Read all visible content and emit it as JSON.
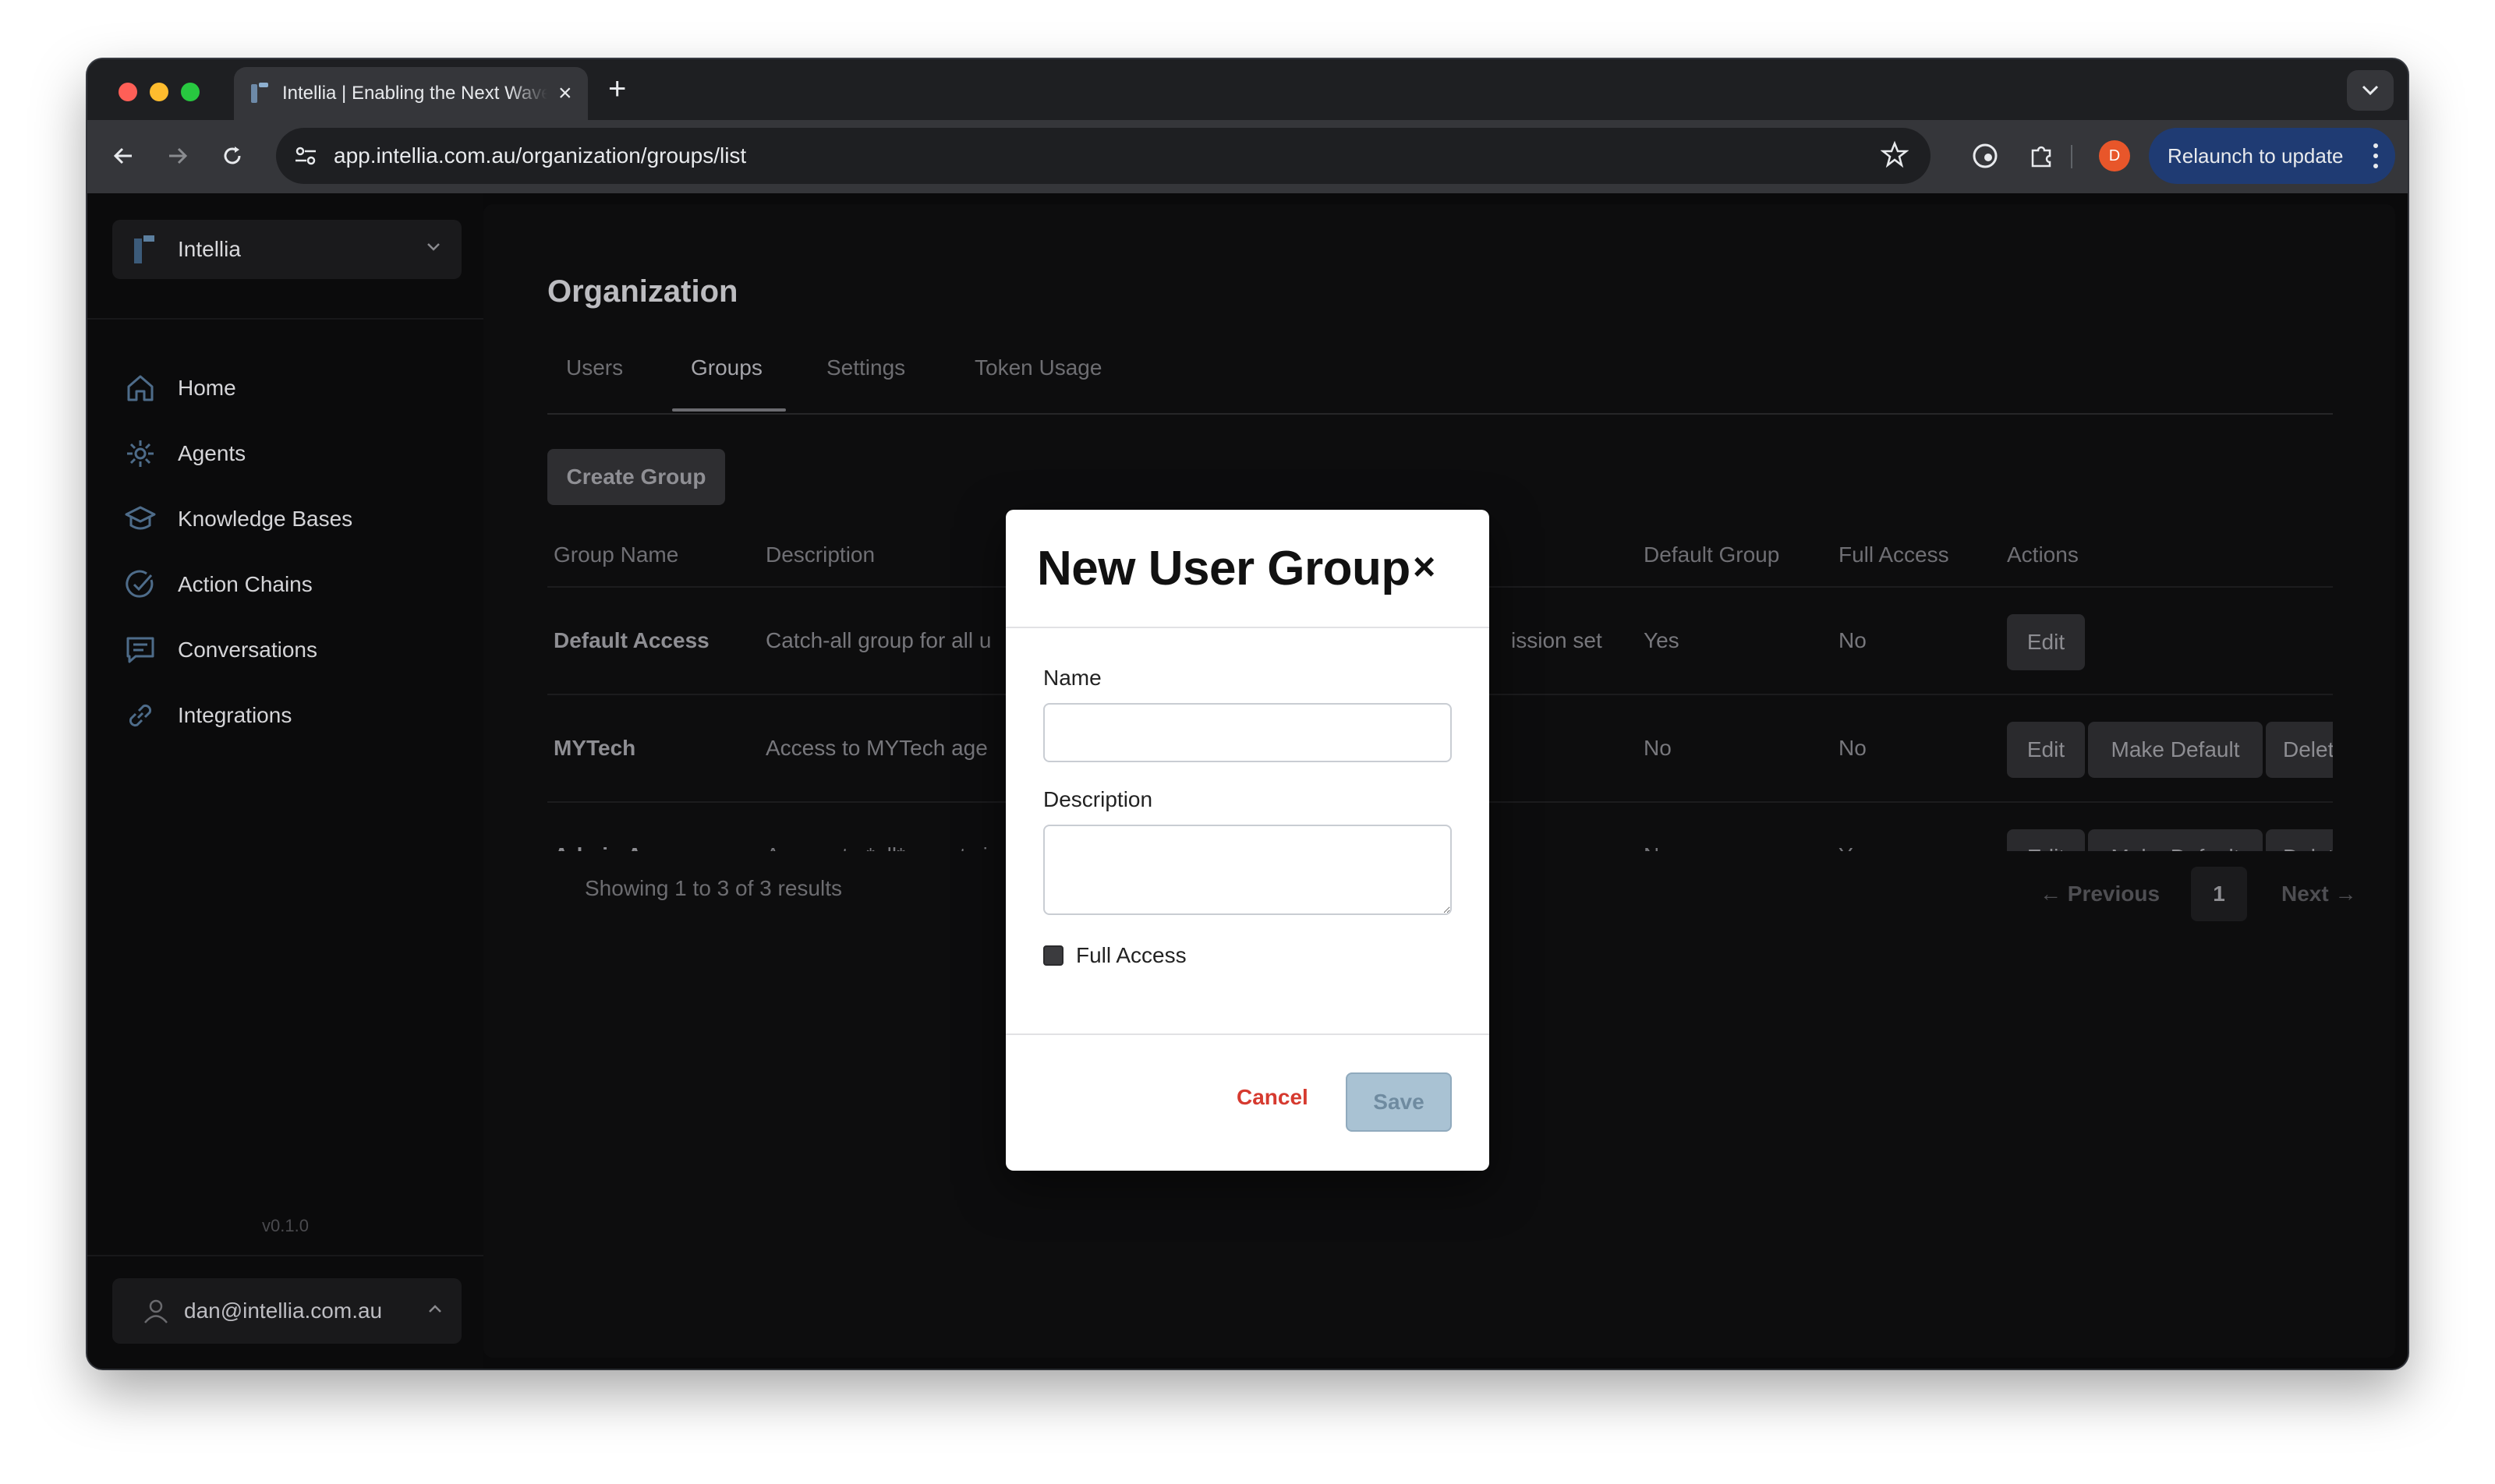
{
  "browser": {
    "tab_title": "Intellia | Enabling the Next Wave",
    "url": "app.intellia.com.au/organization/groups/list",
    "profile_initial": "D",
    "relaunch_label": "Relaunch to update"
  },
  "sidebar": {
    "org_name": "Intellia",
    "items": [
      {
        "label": "Home",
        "icon": "home-icon"
      },
      {
        "label": "Agents",
        "icon": "agents-icon"
      },
      {
        "label": "Knowledge Bases",
        "icon": "knowledge-bases-icon"
      },
      {
        "label": "Action Chains",
        "icon": "action-chains-icon"
      },
      {
        "label": "Conversations",
        "icon": "conversations-icon"
      },
      {
        "label": "Integrations",
        "icon": "integrations-icon"
      }
    ],
    "version": "v0.1.0",
    "user_email": "dan@intellia.com.au"
  },
  "main": {
    "title": "Organization",
    "tabs": [
      "Users",
      "Groups",
      "Settings",
      "Token Usage"
    ],
    "active_tab": "Groups",
    "create_button": "Create Group",
    "columns": [
      "Group Name",
      "Description",
      "Default Group",
      "Full Access",
      "Actions"
    ],
    "rows": [
      {
        "name": "Default Access",
        "description": "Catch-all group for all u",
        "description_tail": "ission set",
        "default": "Yes",
        "full": "No",
        "actions": [
          "Edit"
        ]
      },
      {
        "name": "MYTech",
        "description": "Access to MYTech age",
        "description_tail": "",
        "default": "No",
        "full": "No",
        "actions": [
          "Edit",
          "Make Default",
          "Delete"
        ]
      },
      {
        "name": "Admin Access",
        "description": "Access to *all* agents i",
        "description_tail": "",
        "default": "No",
        "full": "Yes",
        "actions": [
          "Edit",
          "Make Default",
          "Delete"
        ]
      }
    ],
    "results_text": "Showing 1 to 3 of 3 results",
    "pagination": {
      "previous": "← Previous",
      "page": "1",
      "next": "Next →"
    }
  },
  "modal": {
    "title": "New User Group",
    "close_symbol": "×",
    "name_label": "Name",
    "name_value": "",
    "description_label": "Description",
    "description_value": "",
    "full_access_label": "Full Access",
    "cancel_label": "Cancel",
    "save_label": "Save"
  }
}
